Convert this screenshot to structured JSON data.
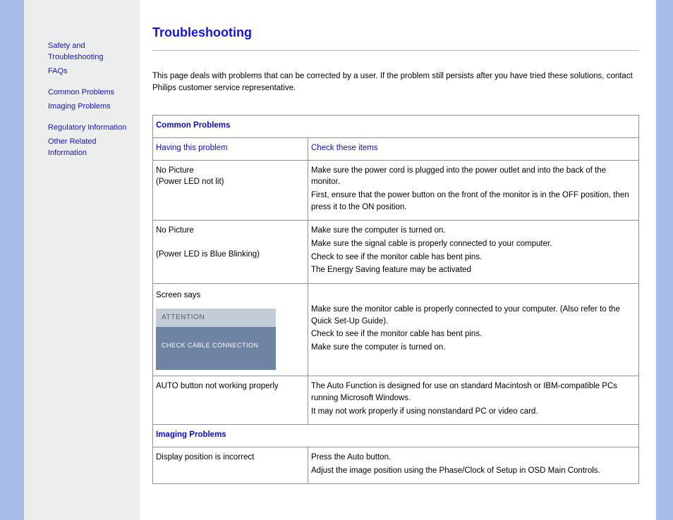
{
  "sidebar": {
    "links": [
      "Safety and Troubleshooting",
      "FAQs",
      "Common Problems",
      "Imaging Problems",
      "Regulatory Information",
      "Other Related Information"
    ]
  },
  "page": {
    "title": "Troubleshooting",
    "intro": "This page deals with problems that can be corrected by a user. If the problem still persists after you have tried these solutions, contact Philips customer service representative."
  },
  "sections": {
    "common": {
      "heading": "Common Problems",
      "col_problem": "Having this problem",
      "col_check": "Check these items",
      "rows": [
        {
          "problem_lines": [
            "No Picture",
            "(Power LED not lit)"
          ],
          "checks": [
            "Make sure the power cord is plugged into the power outlet and into the back of the monitor.",
            "First, ensure that the power button on the front of the monitor is in the OFF position, then press it to the ON position."
          ]
        },
        {
          "problem_lines": [
            "No Picture",
            "",
            "(Power LED is Blue Blinking)"
          ],
          "checks": [
            "Make sure the computer is turned on.",
            "Make sure the signal cable is properly connected to your computer.",
            "Check to see if the monitor cable has bent pins.",
            "The Energy Saving feature may be activated"
          ]
        },
        {
          "problem_lines": [
            "Screen says"
          ],
          "attention_box": {
            "head": "ATTENTION",
            "body": "CHECK CABLE CONNECTION"
          },
          "checks": [
            "Make sure the monitor cable is properly connected to your computer. (Also refer to the Quick Set-Up Guide).",
            "Check to see if the monitor cable has bent pins.",
            "Make sure the computer is turned on."
          ]
        },
        {
          "problem_lines": [
            "AUTO button not working properly"
          ],
          "checks": [
            "The Auto Function is designed for use on standard Macintosh or IBM-compatible PCs running Microsoft Windows.",
            "It may not work properly if using nonstandard PC or video card."
          ]
        }
      ]
    },
    "imaging": {
      "heading": "Imaging Problems",
      "rows": [
        {
          "problem_lines": [
            "Display position is incorrect"
          ],
          "checks": [
            "Press the Auto button.",
            "Adjust the image position using the Phase/Clock of Setup in OSD Main Controls."
          ]
        }
      ]
    }
  }
}
